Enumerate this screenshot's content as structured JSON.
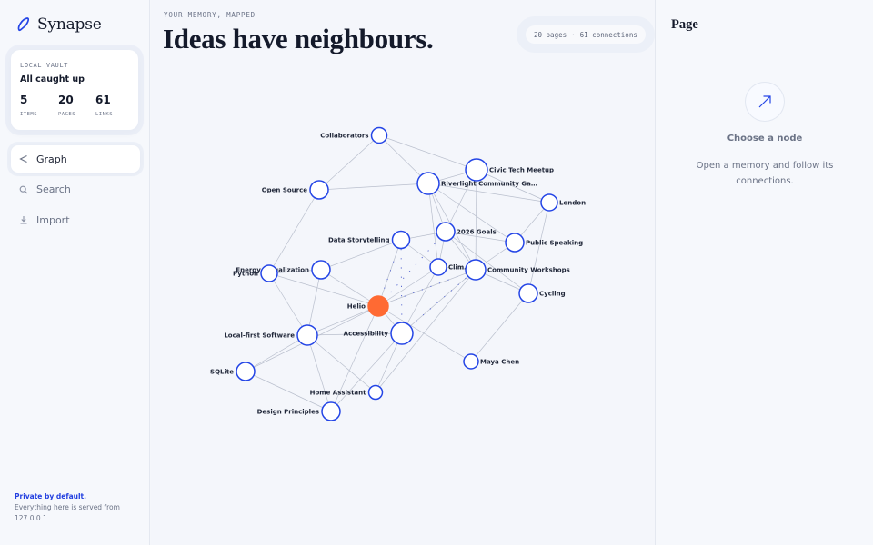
{
  "app": {
    "name": "Synapse"
  },
  "sidebar": {
    "vault": {
      "eyebrow": "LOCAL VAULT",
      "status": "All caught up",
      "stats": [
        {
          "value": "5",
          "label": "ITEMS"
        },
        {
          "value": "20",
          "label": "PAGES"
        },
        {
          "value": "61",
          "label": "LINKS"
        }
      ]
    },
    "nav": [
      {
        "label": "Graph",
        "icon": "share-icon",
        "active": true
      },
      {
        "label": "Search",
        "icon": "search-icon",
        "active": false
      },
      {
        "label": "Import",
        "icon": "download-icon",
        "active": false
      }
    ],
    "privacy": {
      "title": "Private by default.",
      "body": "Everything here is served from 127.0.0.1."
    }
  },
  "main": {
    "eyebrow": "YOUR MEMORY, MAPPED",
    "headline": "Ideas have neighbours.",
    "counts": {
      "pages": "20 pages",
      "separator": "·",
      "connections": "61 connections"
    }
  },
  "graph": {
    "accent": "#ff6a33",
    "node_stroke": "#2445e6",
    "selected": "Helio",
    "nodes": [
      {
        "id": "Collaborators",
        "label": "Collaborators"
      },
      {
        "id": "Civic Tech Meetup",
        "label": "Civic Tech Meetup"
      },
      {
        "id": "Riverlight Community Ga",
        "label": "Riverlight Community Ga…"
      },
      {
        "id": "Open Source",
        "label": "Open Source"
      },
      {
        "id": "London",
        "label": "London"
      },
      {
        "id": "2026 Goals",
        "label": "2026 Goals"
      },
      {
        "id": "Data Storytelling",
        "label": "Data Storytelling"
      },
      {
        "id": "Public Speaking",
        "label": "Public Speaking"
      },
      {
        "id": "Climate",
        "label": "Clim…"
      },
      {
        "id": "Community Workshops",
        "label": "Community Workshops"
      },
      {
        "id": "Energy Visualization",
        "label": "Energy Visualization"
      },
      {
        "id": "Python",
        "label": "Python"
      },
      {
        "id": "Cycling",
        "label": "Cycling"
      },
      {
        "id": "Helio",
        "label": "Helio"
      },
      {
        "id": "Accessibility",
        "label": "Accessibility"
      },
      {
        "id": "Local-first Software",
        "label": "Local-first Software"
      },
      {
        "id": "Maya Chen",
        "label": "Maya Chen"
      },
      {
        "id": "SQLite",
        "label": "SQLite"
      },
      {
        "id": "Home Assistant",
        "label": "Home Assistant"
      },
      {
        "id": "Design Principles",
        "label": "Design Principles"
      }
    ],
    "edges": [
      [
        "Collaborators",
        "Open Source"
      ],
      [
        "Collaborators",
        "Riverlight Community Ga"
      ],
      [
        "Collaborators",
        "Civic Tech Meetup"
      ],
      [
        "Open Source",
        "Riverlight Community Ga"
      ],
      [
        "Open Source",
        "Python"
      ],
      [
        "Civic Tech Meetup",
        "Riverlight Community Ga"
      ],
      [
        "Civic Tech Meetup",
        "London"
      ],
      [
        "Civic Tech Meetup",
        "2026 Goals"
      ],
      [
        "Civic Tech Meetup",
        "Community Workshops"
      ],
      [
        "Riverlight Community Ga",
        "London"
      ],
      [
        "Riverlight Community Ga",
        "2026 Goals"
      ],
      [
        "Riverlight Community Ga",
        "Public Speaking"
      ],
      [
        "Riverlight Community Ga",
        "Community Workshops"
      ],
      [
        "Riverlight Community Ga",
        "Climate"
      ],
      [
        "London",
        "Public Speaking"
      ],
      [
        "London",
        "Cycling"
      ],
      [
        "2026 Goals",
        "Public Speaking"
      ],
      [
        "2026 Goals",
        "Climate"
      ],
      [
        "2026 Goals",
        "Community Workshops"
      ],
      [
        "2026 Goals",
        "Cycling"
      ],
      [
        "Data Storytelling",
        "Energy Visualization"
      ],
      [
        "Data Storytelling",
        "Climate"
      ],
      [
        "Data Storytelling",
        "Helio"
      ],
      [
        "Data Storytelling",
        "2026 Goals"
      ],
      [
        "Public Speaking",
        "Community Workshops"
      ],
      [
        "Climate",
        "Helio"
      ],
      [
        "Climate",
        "Community Workshops"
      ],
      [
        "Climate",
        "Accessibility"
      ],
      [
        "Community Workshops",
        "Helio"
      ],
      [
        "Community Workshops",
        "Cycling"
      ],
      [
        "Community Workshops",
        "Home Assistant"
      ],
      [
        "Community Workshops",
        "Accessibility"
      ],
      [
        "Energy Visualization",
        "Helio"
      ],
      [
        "Energy Visualization",
        "Python"
      ],
      [
        "Energy Visualization",
        "Local-first Software"
      ],
      [
        "Python",
        "Helio"
      ],
      [
        "Python",
        "Local-first Software"
      ],
      [
        "Cycling",
        "Maya Chen"
      ],
      [
        "Helio",
        "Accessibility"
      ],
      [
        "Helio",
        "Local-first Software"
      ],
      [
        "Helio",
        "Maya Chen"
      ],
      [
        "Helio",
        "Design Principles"
      ],
      [
        "Helio",
        "SQLite"
      ],
      [
        "Accessibility",
        "Home Assistant"
      ],
      [
        "Accessibility",
        "Local-first Software"
      ],
      [
        "Local-first Software",
        "SQLite"
      ],
      [
        "Local-first Software",
        "Home Assistant"
      ],
      [
        "Local-first Software",
        "Design Principles"
      ],
      [
        "SQLite",
        "Design Principles"
      ],
      [
        "Accessibility",
        "Design Principles"
      ]
    ],
    "dashed_edges": [
      [
        "Helio",
        "2026 Goals"
      ],
      [
        "Helio",
        "Community Workshops"
      ],
      [
        "Helio",
        "Data Storytelling"
      ],
      [
        "Accessibility",
        "Community Workshops"
      ],
      [
        "Accessibility",
        "Data Storytelling"
      ]
    ]
  },
  "panel": {
    "title": "Page",
    "empty_icon": "arrow-up-right-icon",
    "empty_title": "Choose a node",
    "empty_body": "Open a memory and follow its connections."
  }
}
